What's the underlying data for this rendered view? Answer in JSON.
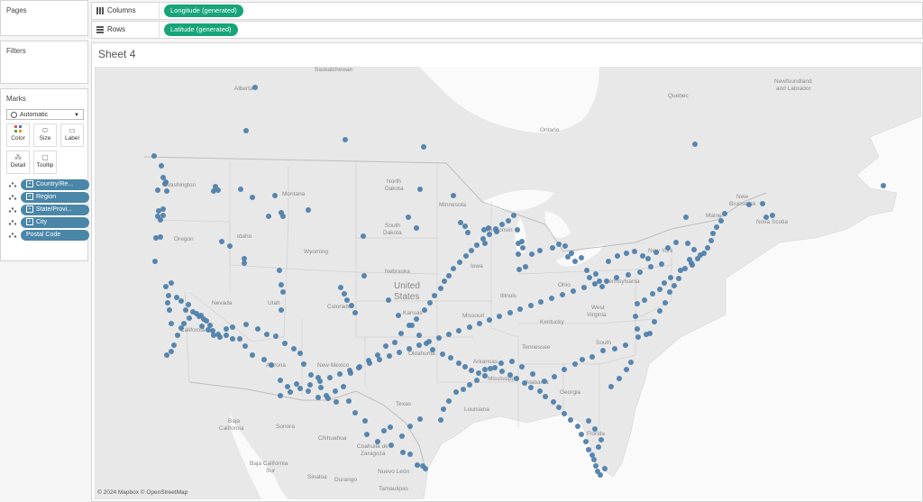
{
  "pages": {
    "title": "Pages"
  },
  "filters": {
    "title": "Filters"
  },
  "marks": {
    "title": "Marks",
    "type": "Automatic",
    "buttons": [
      "Color",
      "Size",
      "Label",
      "Detail",
      "Tooltip"
    ],
    "fields": [
      "Country/Re...",
      "Region",
      "State/Provi...",
      "City",
      "Postal Code"
    ]
  },
  "columns": {
    "label": "Columns",
    "pill": "Longitude (generated)"
  },
  "rows": {
    "label": "Rows",
    "pill": "Latitude (generated)"
  },
  "sheet": {
    "title": "Sheet 4"
  },
  "map": {
    "credit": "© 2024 Mapbox © OpenStreetMap",
    "dot_color": "#4f7fab",
    "labels": {
      "saskatchewan": "Saskatchewan",
      "alberta": "Alberta",
      "newfoundland": "Newfoundland",
      "labrador": "and Labrador",
      "quebec": "Quebec",
      "ontario": "Ontario",
      "new_brunswick": "New",
      "new_brunswick2": "Brunswick",
      "nova_scotia": "Nova Scotia",
      "maine": "Maine",
      "washington": "Washington",
      "montana": "Montana",
      "north_dakota": "North",
      "north_dakota2": "Dakota",
      "minnesota": "Minnesota",
      "wisconsin": "Wisconsin",
      "south_dakota": "South",
      "south_dakota2": "Dakota",
      "oregon": "Oregon",
      "idaho": "Idaho",
      "wyoming": "Wyoming",
      "iowa": "Iowa",
      "nebraska": "Nebraska",
      "united": "United",
      "states": "States",
      "ohio": "Ohio",
      "pennsylvania": "Pennsylvania",
      "new_york": "New York",
      "nevada": "Nevada",
      "utah": "Utah",
      "colorado": "Colorado",
      "kansas": "Kansas",
      "missouri": "Missouri",
      "illinois": "Illinois",
      "kentucky": "Kentucky",
      "west_virginia": "West",
      "west_virginia2": "Virginia",
      "california": "California",
      "arizona": "Arizona",
      "new_mexico": "New Mexico",
      "oklahoma": "Oklahoma",
      "arkansas": "Arkansas",
      "tennessee": "Tennessee",
      "south_carolina": "South",
      "georgia": "Georgia",
      "mississippi": "Mississippi",
      "alabama": "Alabama",
      "texas": "Texas",
      "louisiana": "Louisiana",
      "florida": "Florida",
      "baja_california": "Baja",
      "baja_california2": "California",
      "sonora": "Sonora",
      "chihuahua": "Chihuahua",
      "coahuila": "Coahuila de",
      "coahuila2": "Zaragoza",
      "nuevo_leon": "Nuevo León",
      "baja_sur": "Baja California",
      "baja_sur2": "Sur",
      "sinaloa": "Sinaloa",
      "durango": "Durango",
      "tamaulipas": "Tamaulipas"
    }
  }
}
